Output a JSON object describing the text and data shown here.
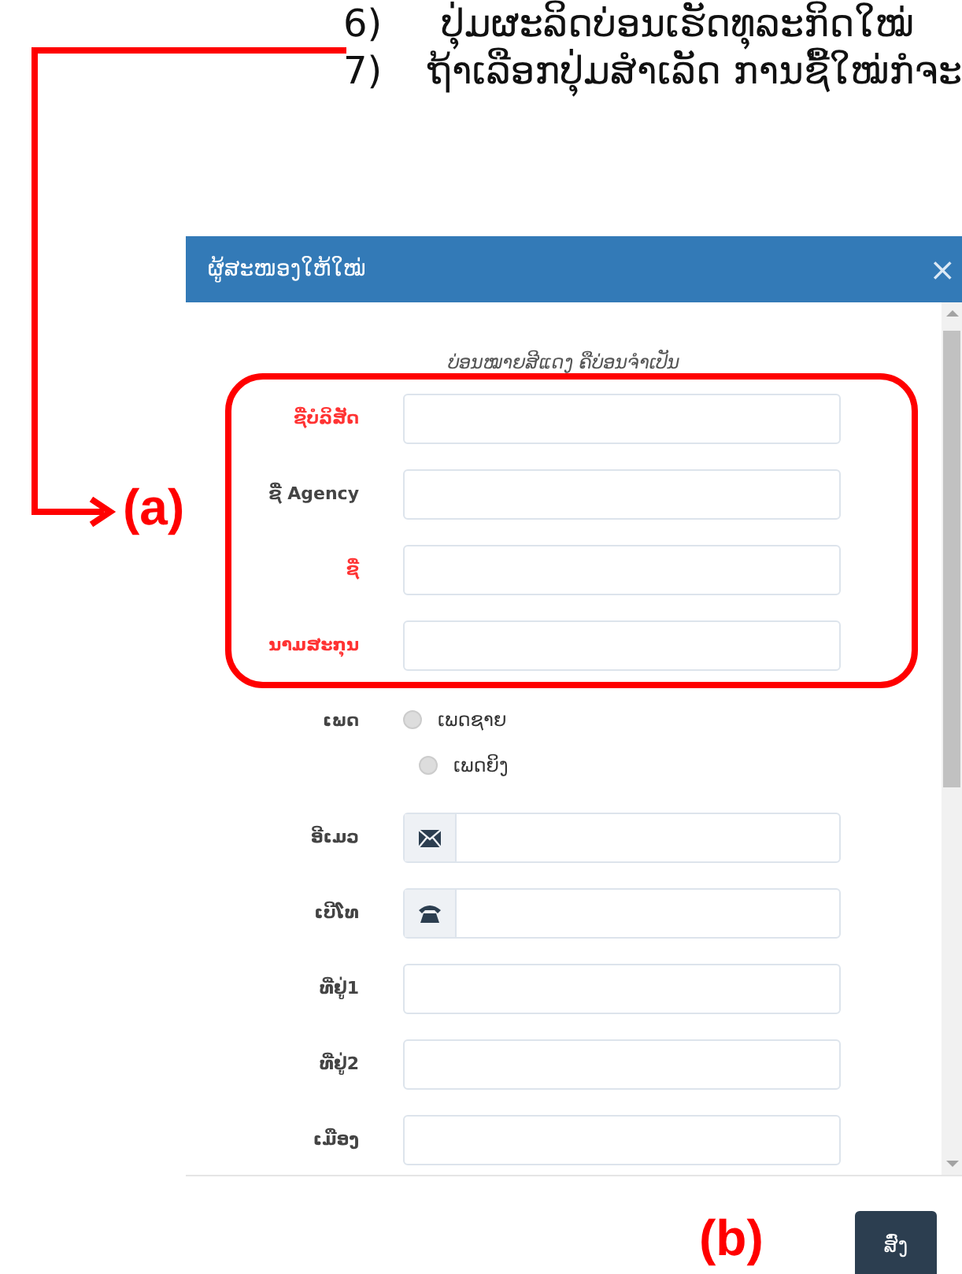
{
  "instructions": [
    {
      "number": "6)",
      "text": "ປຸ່ມຜະລິດບ່ອນເຮັດທຸລະກິດໃໝ່"
    },
    {
      "number": "7)",
      "text": "ຖ້າເລືອກປຸ່ມສຳເລັດ ການຊື້ໃໝ່ກໍຈະ"
    }
  ],
  "callout_a": "(a)",
  "callout_b": "(b)",
  "dialog": {
    "title": "ຜູ້ສະໜອງໃຫ້ໃໝ່",
    "close": "×",
    "note": "ບ່ອນໝາຍສີແດງ ຄືບ່ອນຈຳເປັນ",
    "fields": [
      {
        "kind": "text",
        "label": "ຊື່ບໍລິສັດ",
        "required": true
      },
      {
        "kind": "text",
        "label": "ຊື່ Agency",
        "required": false
      },
      {
        "kind": "text",
        "label": "ຊື່",
        "required": true
      },
      {
        "kind": "text",
        "label": "ນາມສະກຸນ",
        "required": true
      },
      {
        "kind": "radio",
        "label": "ເພດ",
        "required": false,
        "options": [
          {
            "label": "ເພດຊາຍ",
            "selected": false
          },
          {
            "label": "ເພດຍິງ",
            "selected": false
          }
        ]
      },
      {
        "kind": "email",
        "label": "ອີເມວ",
        "required": false
      },
      {
        "kind": "phone",
        "label": "ເບີໂທ",
        "required": false
      },
      {
        "kind": "text",
        "label": "ທີ່ຢູ່1",
        "required": false
      },
      {
        "kind": "text",
        "label": "ທີ່ຢູ່2",
        "required": false
      },
      {
        "kind": "text",
        "label": "ເມືອງ",
        "required": false
      }
    ],
    "submit": "ສົ່ງ"
  }
}
